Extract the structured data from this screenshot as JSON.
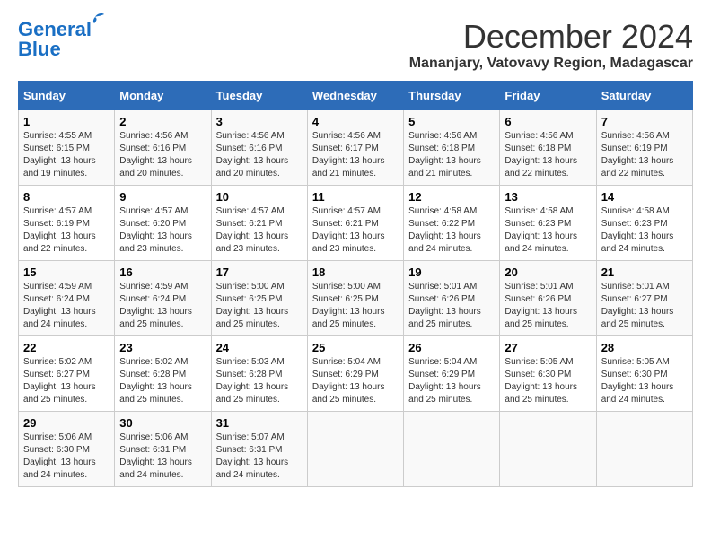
{
  "logo": {
    "line1": "General",
    "line2": "Blue"
  },
  "title": "December 2024",
  "location": "Mananjary, Vatovavy Region, Madagascar",
  "weekdays": [
    "Sunday",
    "Monday",
    "Tuesday",
    "Wednesday",
    "Thursday",
    "Friday",
    "Saturday"
  ],
  "weeks": [
    [
      {
        "day": "1",
        "sunrise": "4:55 AM",
        "sunset": "6:15 PM",
        "daylight": "13 hours and 19 minutes."
      },
      {
        "day": "2",
        "sunrise": "4:56 AM",
        "sunset": "6:16 PM",
        "daylight": "13 hours and 20 minutes."
      },
      {
        "day": "3",
        "sunrise": "4:56 AM",
        "sunset": "6:16 PM",
        "daylight": "13 hours and 20 minutes."
      },
      {
        "day": "4",
        "sunrise": "4:56 AM",
        "sunset": "6:17 PM",
        "daylight": "13 hours and 21 minutes."
      },
      {
        "day": "5",
        "sunrise": "4:56 AM",
        "sunset": "6:18 PM",
        "daylight": "13 hours and 21 minutes."
      },
      {
        "day": "6",
        "sunrise": "4:56 AM",
        "sunset": "6:18 PM",
        "daylight": "13 hours and 22 minutes."
      },
      {
        "day": "7",
        "sunrise": "4:56 AM",
        "sunset": "6:19 PM",
        "daylight": "13 hours and 22 minutes."
      }
    ],
    [
      {
        "day": "8",
        "sunrise": "4:57 AM",
        "sunset": "6:19 PM",
        "daylight": "13 hours and 22 minutes."
      },
      {
        "day": "9",
        "sunrise": "4:57 AM",
        "sunset": "6:20 PM",
        "daylight": "13 hours and 23 minutes."
      },
      {
        "day": "10",
        "sunrise": "4:57 AM",
        "sunset": "6:21 PM",
        "daylight": "13 hours and 23 minutes."
      },
      {
        "day": "11",
        "sunrise": "4:57 AM",
        "sunset": "6:21 PM",
        "daylight": "13 hours and 23 minutes."
      },
      {
        "day": "12",
        "sunrise": "4:58 AM",
        "sunset": "6:22 PM",
        "daylight": "13 hours and 24 minutes."
      },
      {
        "day": "13",
        "sunrise": "4:58 AM",
        "sunset": "6:23 PM",
        "daylight": "13 hours and 24 minutes."
      },
      {
        "day": "14",
        "sunrise": "4:58 AM",
        "sunset": "6:23 PM",
        "daylight": "13 hours and 24 minutes."
      }
    ],
    [
      {
        "day": "15",
        "sunrise": "4:59 AM",
        "sunset": "6:24 PM",
        "daylight": "13 hours and 24 minutes."
      },
      {
        "day": "16",
        "sunrise": "4:59 AM",
        "sunset": "6:24 PM",
        "daylight": "13 hours and 25 minutes."
      },
      {
        "day": "17",
        "sunrise": "5:00 AM",
        "sunset": "6:25 PM",
        "daylight": "13 hours and 25 minutes."
      },
      {
        "day": "18",
        "sunrise": "5:00 AM",
        "sunset": "6:25 PM",
        "daylight": "13 hours and 25 minutes."
      },
      {
        "day": "19",
        "sunrise": "5:01 AM",
        "sunset": "6:26 PM",
        "daylight": "13 hours and 25 minutes."
      },
      {
        "day": "20",
        "sunrise": "5:01 AM",
        "sunset": "6:26 PM",
        "daylight": "13 hours and 25 minutes."
      },
      {
        "day": "21",
        "sunrise": "5:01 AM",
        "sunset": "6:27 PM",
        "daylight": "13 hours and 25 minutes."
      }
    ],
    [
      {
        "day": "22",
        "sunrise": "5:02 AM",
        "sunset": "6:27 PM",
        "daylight": "13 hours and 25 minutes."
      },
      {
        "day": "23",
        "sunrise": "5:02 AM",
        "sunset": "6:28 PM",
        "daylight": "13 hours and 25 minutes."
      },
      {
        "day": "24",
        "sunrise": "5:03 AM",
        "sunset": "6:28 PM",
        "daylight": "13 hours and 25 minutes."
      },
      {
        "day": "25",
        "sunrise": "5:04 AM",
        "sunset": "6:29 PM",
        "daylight": "13 hours and 25 minutes."
      },
      {
        "day": "26",
        "sunrise": "5:04 AM",
        "sunset": "6:29 PM",
        "daylight": "13 hours and 25 minutes."
      },
      {
        "day": "27",
        "sunrise": "5:05 AM",
        "sunset": "6:30 PM",
        "daylight": "13 hours and 25 minutes."
      },
      {
        "day": "28",
        "sunrise": "5:05 AM",
        "sunset": "6:30 PM",
        "daylight": "13 hours and 24 minutes."
      }
    ],
    [
      {
        "day": "29",
        "sunrise": "5:06 AM",
        "sunset": "6:30 PM",
        "daylight": "13 hours and 24 minutes."
      },
      {
        "day": "30",
        "sunrise": "5:06 AM",
        "sunset": "6:31 PM",
        "daylight": "13 hours and 24 minutes."
      },
      {
        "day": "31",
        "sunrise": "5:07 AM",
        "sunset": "6:31 PM",
        "daylight": "13 hours and 24 minutes."
      },
      null,
      null,
      null,
      null
    ]
  ]
}
